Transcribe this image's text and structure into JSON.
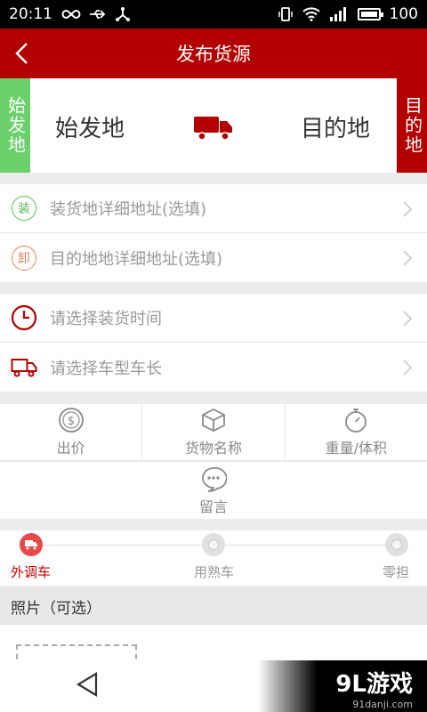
{
  "statusbar": {
    "time": "20:11",
    "battery": "100"
  },
  "appbar": {
    "title": "发布货源"
  },
  "route": {
    "tag_from": "始发地",
    "tag_to": "目的地",
    "origin": "始发地",
    "destination": "目的地"
  },
  "address_rows": [
    {
      "badge": "装",
      "label": "装货地详细地址(选填)",
      "color": "#5cb85c"
    },
    {
      "badge": "卸",
      "label": "目的地地详细地址(选填)",
      "color": "#e8845a"
    }
  ],
  "option_rows": [
    {
      "label": "请选择装货时间"
    },
    {
      "label": "请选择车型车长"
    }
  ],
  "grid": [
    {
      "label": "出价"
    },
    {
      "label": "货物名称"
    },
    {
      "label": "重量/体积"
    }
  ],
  "message": {
    "label": "留言"
  },
  "steps": [
    {
      "label": "外调车"
    },
    {
      "label": "用熟车"
    },
    {
      "label": "零担"
    }
  ],
  "photos": {
    "header": "照片（可选）"
  },
  "watermark": {
    "brand": "9L游戏",
    "site": "91danji.com"
  },
  "colors": {
    "brand_red": "#b30000",
    "green": "#6cd06c"
  }
}
